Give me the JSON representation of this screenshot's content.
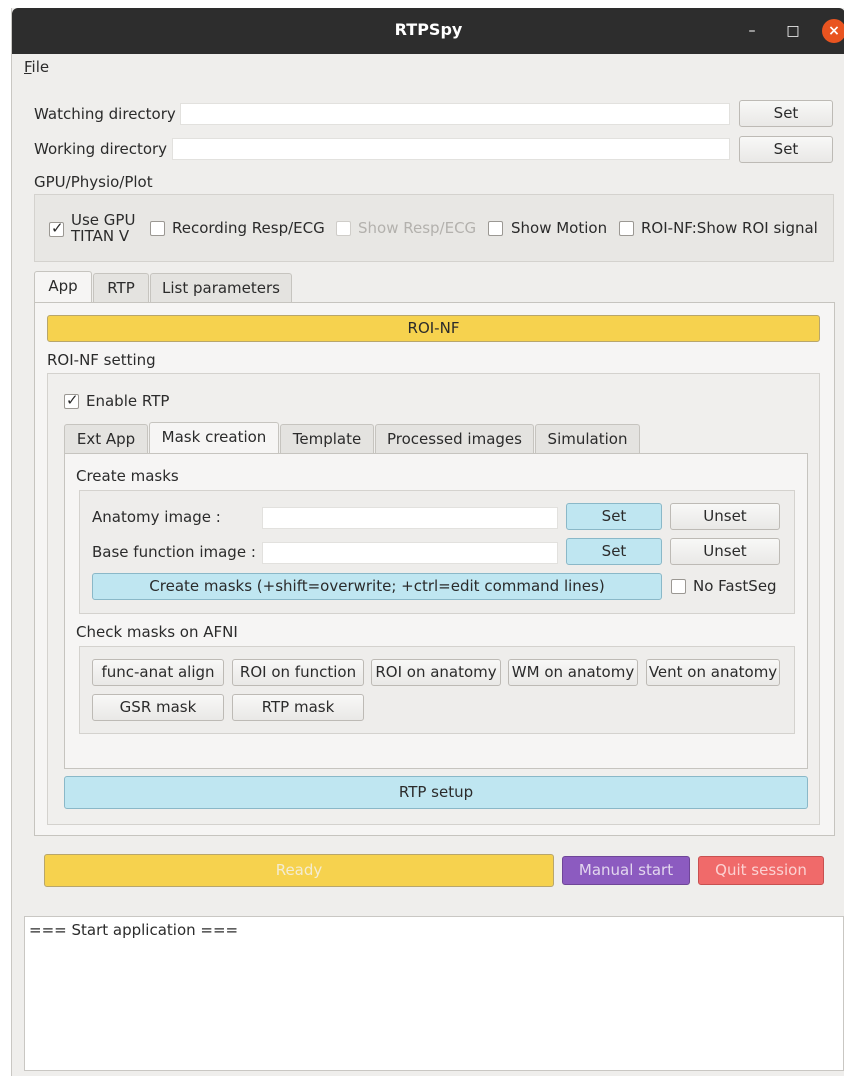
{
  "window": {
    "title": "RTPSpy",
    "minimize_glyph": "–",
    "maximize_glyph": "□",
    "close_glyph": "×"
  },
  "menu": {
    "file_underlined": "F",
    "file_rest": "ile"
  },
  "dirs": {
    "watching_label": "Watching directory",
    "watching_value": "",
    "working_label": "Working directory",
    "working_value": "",
    "set_label": "Set"
  },
  "gpu_section": {
    "title": "GPU/Physio/Plot",
    "use_gpu_line1": "Use GPU",
    "use_gpu_line2": "TITAN V",
    "recording": "Recording Resp/ECG",
    "show_resp": "Show Resp/ECG",
    "show_motion": "Show Motion",
    "roi_signal": "ROI-NF:Show ROI signal",
    "checkmark": "✓"
  },
  "main_tabs": [
    "App",
    "RTP",
    "List parameters"
  ],
  "roinf_button": "ROI-NF",
  "roinf_setting": {
    "title": "ROI-NF setting",
    "enable_rtp": "Enable RTP"
  },
  "sub_tabs": [
    "Ext App",
    "Mask creation",
    "Template",
    "Processed images",
    "Simulation"
  ],
  "create_masks": {
    "title": "Create masks",
    "anatomy_label": "Anatomy image :",
    "anatomy_value": "",
    "base_label": "Base function image :",
    "base_value": "",
    "set_label": "Set",
    "unset_label": "Unset",
    "create_button": "Create masks (+shift=overwrite; +ctrl=edit command lines)",
    "no_fastseg": "No FastSeg"
  },
  "check_masks": {
    "title": "Check masks on AFNI",
    "buttons": [
      "func-anat align",
      "ROI on function",
      "ROI on anatomy",
      "WM on anatomy",
      "Vent on anatomy",
      "GSR mask",
      "RTP mask"
    ]
  },
  "rtp_setup": "RTP setup",
  "bottom": {
    "ready": "Ready",
    "manual_start": "Manual start",
    "quit_session": "Quit session"
  },
  "log": {
    "text": "=== Start application ==="
  },
  "colors": {
    "titlebar": "#2d2d2d",
    "close": "#e95420",
    "roinf_yellow": "#f6d24e",
    "blue_button": "#bfe6f1",
    "manual_purple": "#8c5bc0",
    "quit_red": "#f06a6a"
  }
}
